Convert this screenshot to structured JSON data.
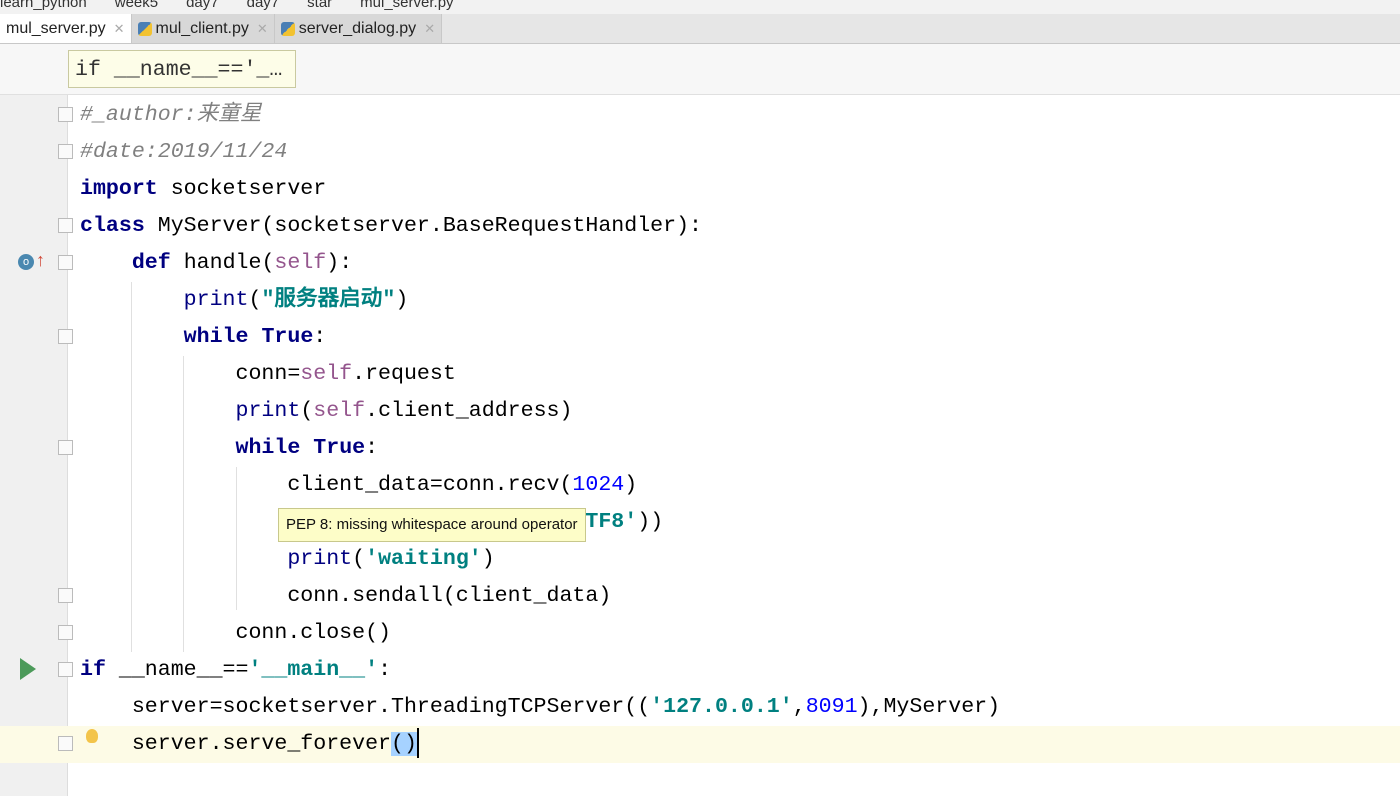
{
  "breadcrumbs": [
    "learn_python",
    "week5",
    "day7",
    "day7",
    "star",
    "mul_server.py"
  ],
  "tabs": [
    {
      "label": "mul_server.py",
      "active": true
    },
    {
      "label": "mul_client.py"
    },
    {
      "label": "server_dialog.py"
    }
  ],
  "sticky_header": "if __name__=='_…",
  "tooltip": "PEP 8: missing whitespace around operator",
  "code_lines": [
    [
      [
        "#_author:来童星",
        "cm"
      ]
    ],
    [
      [
        "#date:2019/11/24",
        "cm"
      ]
    ],
    [
      [
        "import",
        "kw"
      ],
      [
        " socketserver",
        ""
      ]
    ],
    [
      [
        "class",
        "kw"
      ],
      [
        " MyServer(socketserver.BaseRequestHandler):",
        ""
      ]
    ],
    [
      [
        "    ",
        ""
      ],
      [
        "def",
        "kw"
      ],
      [
        " handle(",
        ""
      ],
      [
        "self",
        "sf"
      ],
      [
        "):",
        ""
      ]
    ],
    [
      [
        "        ",
        ""
      ],
      [
        "print",
        "bi"
      ],
      [
        "(",
        ""
      ],
      [
        "\"服务器启动\"",
        "st"
      ],
      [
        ")",
        ""
      ]
    ],
    [
      [
        "        ",
        ""
      ],
      [
        "while",
        "kw"
      ],
      [
        " ",
        ""
      ],
      [
        "True",
        "kw"
      ],
      [
        ":",
        ""
      ]
    ],
    [
      [
        "            conn=",
        ""
      ],
      [
        "self",
        "sf"
      ],
      [
        ".request",
        ""
      ]
    ],
    [
      [
        "            ",
        ""
      ],
      [
        "print",
        "bi"
      ],
      [
        "(",
        ""
      ],
      [
        "self",
        "sf"
      ],
      [
        ".client_address)",
        ""
      ]
    ],
    [
      [
        "            ",
        ""
      ],
      [
        "while",
        "kw"
      ],
      [
        " ",
        ""
      ],
      [
        "True",
        "kw"
      ],
      [
        ":",
        ""
      ]
    ],
    [
      [
        "                client_data=conn.recv(",
        ""
      ],
      [
        "1024",
        "num"
      ],
      [
        ")",
        ""
      ]
    ],
    [
      [
        "                                       ",
        ""
      ],
      [
        "TF8'",
        "st"
      ],
      [
        "))",
        ""
      ]
    ],
    [
      [
        "                ",
        ""
      ],
      [
        "print",
        "bi"
      ],
      [
        "(",
        ""
      ],
      [
        "'waiting'",
        "st"
      ],
      [
        ")",
        ""
      ]
    ],
    [
      [
        "                conn.sendall(client_data)",
        ""
      ]
    ],
    [
      [
        "            conn.close()",
        ""
      ]
    ],
    [
      [
        "if",
        "kw"
      ],
      [
        " __name__==",
        ""
      ],
      [
        "'__main__'",
        "st"
      ],
      [
        ":",
        ""
      ]
    ],
    [
      [
        "    server=socketserver.ThreadingTCPServer((",
        ""
      ],
      [
        "'127.0.0.1'",
        "st"
      ],
      [
        ",",
        ""
      ],
      [
        "8091",
        "num"
      ],
      [
        "),MyServer)",
        ""
      ]
    ],
    [
      [
        "    server.serve_forever",
        ""
      ],
      [
        "()",
        "sel"
      ]
    ]
  ],
  "icons": {
    "run": "run-icon",
    "override": "override-method-icon",
    "intention": "lightbulb-icon"
  }
}
